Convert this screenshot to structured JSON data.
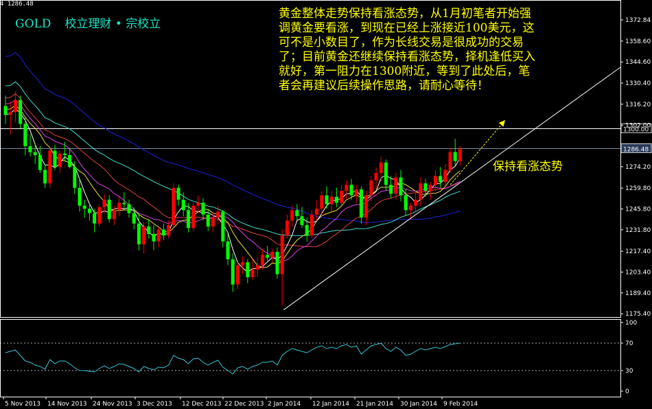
{
  "header": {
    "top_value": "4 1286.48",
    "symbol": "GOLD",
    "author": "校立理财 • 宗校立"
  },
  "annotation": {
    "note": "黄金整体走势保持看涨态势，从1月初笔者开始强调黄金要看涨，到现在已经上涨接近100美元，这可不是小数目了，作为长线交易是很成功的交易了；目前黄金还继续保持看涨态势，择机逢低买入就好，第一阻力在1300附近，等到了此处后，笔者会再建议后续操作思路，请耐心等待！",
    "trend_label": "保持看涨态势"
  },
  "colors": {
    "background": "#000000",
    "bull_candle": "#ff0000",
    "bear_candle": "#00ff00",
    "axis": "#ffffff",
    "note_text": "#ffff00",
    "title_text": "#18e7c8",
    "indicator": "#37c8d8",
    "ma_blue": "#2020e0",
    "ma_cyan": "#40e0d0",
    "ma_red": "#e04040",
    "ma_magenta": "#e040e0",
    "ma_yellow": "#f0e040",
    "ma_white": "#ffffff"
  },
  "chart_data": [
    {
      "type": "candlestick",
      "title": "GOLD",
      "ylim": [
        1175.48,
        1372.84
      ],
      "yticks": [
        1372.84,
        1358.6,
        1344.6,
        1330.4,
        1316.2,
        1302.0,
        1300.0,
        1286.48,
        1274.2,
        1259.8,
        1245.8,
        1231.8,
        1217.4,
        1203.4,
        1189.4,
        1175.4
      ],
      "ytick_labels": [
        "1372.84",
        "1358.60",
        "1344.60",
        "1330.40",
        "1316.20",
        "1302.00",
        "1300.00",
        "1286.48",
        "1274.20",
        "1259.80",
        "1245.80",
        "1231.80",
        "1217.40",
        "1203.40",
        "1189.40",
        "1175.40"
      ],
      "xtick_labels": [
        "5 Nov 2013",
        "14 Nov 2013",
        "24 Nov 2013",
        "3 Dec 2013",
        "12 Dec 2013",
        "22 Dec 2013",
        "2 Jan 2014",
        "12 Jan 2014",
        "21 Jan 2014",
        "30 Jan 2014",
        "9 Feb 2014"
      ],
      "horizontal_lines": [
        {
          "value": 1300.0,
          "label": "1300.00"
        },
        {
          "value": 1286.48,
          "label": "1286.48"
        }
      ],
      "last_price": 1286.48,
      "candles": [
        [
          1315,
          1322,
          1303,
          1309
        ],
        [
          1309,
          1318,
          1296,
          1311
        ],
        [
          1311,
          1325,
          1304,
          1319
        ],
        [
          1319,
          1322,
          1300,
          1303
        ],
        [
          1303,
          1307,
          1282,
          1288
        ],
        [
          1288,
          1296,
          1281,
          1284
        ],
        [
          1284,
          1290,
          1276,
          1282
        ],
        [
          1282,
          1288,
          1270,
          1272
        ],
        [
          1272,
          1276,
          1260,
          1263
        ],
        [
          1263,
          1287,
          1260,
          1285
        ],
        [
          1285,
          1289,
          1272,
          1274
        ],
        [
          1274,
          1285,
          1270,
          1283
        ],
        [
          1283,
          1291,
          1278,
          1282
        ],
        [
          1282,
          1287,
          1273,
          1274
        ],
        [
          1274,
          1278,
          1256,
          1260
        ],
        [
          1260,
          1266,
          1244,
          1248
        ],
        [
          1248,
          1252,
          1240,
          1246
        ],
        [
          1246,
          1250,
          1238,
          1243
        ],
        [
          1243,
          1246,
          1230,
          1236
        ],
        [
          1236,
          1249,
          1234,
          1247
        ],
        [
          1247,
          1256,
          1243,
          1252
        ],
        [
          1252,
          1255,
          1237,
          1239
        ],
        [
          1239,
          1248,
          1235,
          1245
        ],
        [
          1245,
          1254,
          1241,
          1250
        ],
        [
          1250,
          1257,
          1246,
          1249
        ],
        [
          1249,
          1252,
          1240,
          1243
        ],
        [
          1243,
          1247,
          1232,
          1236
        ],
        [
          1236,
          1243,
          1218,
          1222
        ],
        [
          1222,
          1237,
          1216,
          1234
        ],
        [
          1234,
          1239,
          1226,
          1229
        ],
        [
          1229,
          1235,
          1218,
          1224
        ],
        [
          1224,
          1234,
          1220,
          1232
        ],
        [
          1232,
          1236,
          1225,
          1228
        ],
        [
          1228,
          1238,
          1226,
          1235
        ],
        [
          1235,
          1263,
          1233,
          1260
        ],
        [
          1260,
          1262,
          1248,
          1252
        ],
        [
          1252,
          1257,
          1241,
          1245
        ],
        [
          1245,
          1250,
          1230,
          1233
        ],
        [
          1233,
          1250,
          1231,
          1248
        ],
        [
          1248,
          1255,
          1243,
          1250
        ],
        [
          1250,
          1253,
          1238,
          1242
        ],
        [
          1242,
          1246,
          1231,
          1234
        ],
        [
          1234,
          1244,
          1230,
          1240
        ],
        [
          1240,
          1248,
          1236,
          1244
        ],
        [
          1244,
          1245,
          1220,
          1224
        ],
        [
          1224,
          1229,
          1208,
          1212
        ],
        [
          1212,
          1216,
          1190,
          1195
        ],
        [
          1195,
          1210,
          1192,
          1208
        ],
        [
          1208,
          1214,
          1202,
          1210
        ],
        [
          1210,
          1212,
          1196,
          1200
        ],
        [
          1200,
          1212,
          1198,
          1205
        ],
        [
          1205,
          1214,
          1200,
          1208
        ],
        [
          1208,
          1219,
          1205,
          1215
        ],
        [
          1215,
          1221,
          1211,
          1213
        ],
        [
          1213,
          1219,
          1210,
          1217
        ],
        [
          1217,
          1220,
          1199,
          1202
        ],
        [
          1202,
          1232,
          1181,
          1228
        ],
        [
          1228,
          1242,
          1226,
          1238
        ],
        [
          1238,
          1248,
          1234,
          1245
        ],
        [
          1245,
          1249,
          1238,
          1241
        ],
        [
          1241,
          1247,
          1233,
          1235
        ],
        [
          1235,
          1240,
          1224,
          1228
        ],
        [
          1228,
          1245,
          1226,
          1242
        ],
        [
          1242,
          1252,
          1238,
          1246
        ],
        [
          1246,
          1258,
          1241,
          1255
        ],
        [
          1255,
          1261,
          1246,
          1249
        ],
        [
          1249,
          1258,
          1244,
          1254
        ],
        [
          1254,
          1260,
          1247,
          1250
        ],
        [
          1250,
          1262,
          1248,
          1258
        ],
        [
          1258,
          1265,
          1252,
          1262
        ],
        [
          1262,
          1266,
          1252,
          1255
        ],
        [
          1255,
          1262,
          1250,
          1259
        ],
        [
          1259,
          1261,
          1236,
          1240
        ],
        [
          1240,
          1258,
          1235,
          1255
        ],
        [
          1255,
          1268,
          1251,
          1265
        ],
        [
          1265,
          1274,
          1259,
          1270
        ],
        [
          1270,
          1281,
          1264,
          1277
        ],
        [
          1277,
          1279,
          1258,
          1262
        ],
        [
          1262,
          1268,
          1253,
          1256
        ],
        [
          1256,
          1270,
          1252,
          1267
        ],
        [
          1267,
          1272,
          1251,
          1255
        ],
        [
          1255,
          1259,
          1241,
          1245
        ],
        [
          1245,
          1250,
          1239,
          1248
        ],
        [
          1248,
          1258,
          1244,
          1252
        ],
        [
          1252,
          1267,
          1248,
          1263
        ],
        [
          1263,
          1266,
          1254,
          1258
        ],
        [
          1258,
          1264,
          1252,
          1262
        ],
        [
          1262,
          1272,
          1258,
          1268
        ],
        [
          1268,
          1274,
          1260,
          1264
        ],
        [
          1264,
          1276,
          1261,
          1272
        ],
        [
          1272,
          1287,
          1270,
          1284
        ],
        [
          1284,
          1293,
          1275,
          1278
        ],
        [
          1278,
          1288,
          1275,
          1286
        ]
      ]
    },
    {
      "type": "line",
      "title": "",
      "ylim": [
        0,
        100
      ],
      "yticks": [
        0,
        30,
        70,
        100
      ],
      "ytick_labels": [
        "0",
        "30",
        "70",
        "100"
      ],
      "levels": [
        30,
        70
      ],
      "values": [
        56,
        58,
        60,
        52,
        44,
        42,
        38,
        36,
        32,
        46,
        40,
        44,
        44,
        40,
        34,
        30,
        30,
        29,
        28,
        33,
        37,
        33,
        36,
        40,
        39,
        36,
        33,
        28,
        36,
        33,
        31,
        35,
        34,
        38,
        52,
        48,
        46,
        40,
        47,
        48,
        42,
        38,
        42,
        45,
        35,
        30,
        25,
        34,
        36,
        32,
        36,
        38,
        42,
        42,
        44,
        38,
        52,
        58,
        62,
        60,
        58,
        56,
        60,
        64,
        66,
        62,
        64,
        62,
        66,
        68,
        64,
        66,
        54,
        60,
        66,
        68,
        70,
        62,
        58,
        64,
        60,
        52,
        54,
        58,
        62,
        60,
        62,
        64,
        62,
        65,
        68,
        69,
        70
      ]
    }
  ]
}
